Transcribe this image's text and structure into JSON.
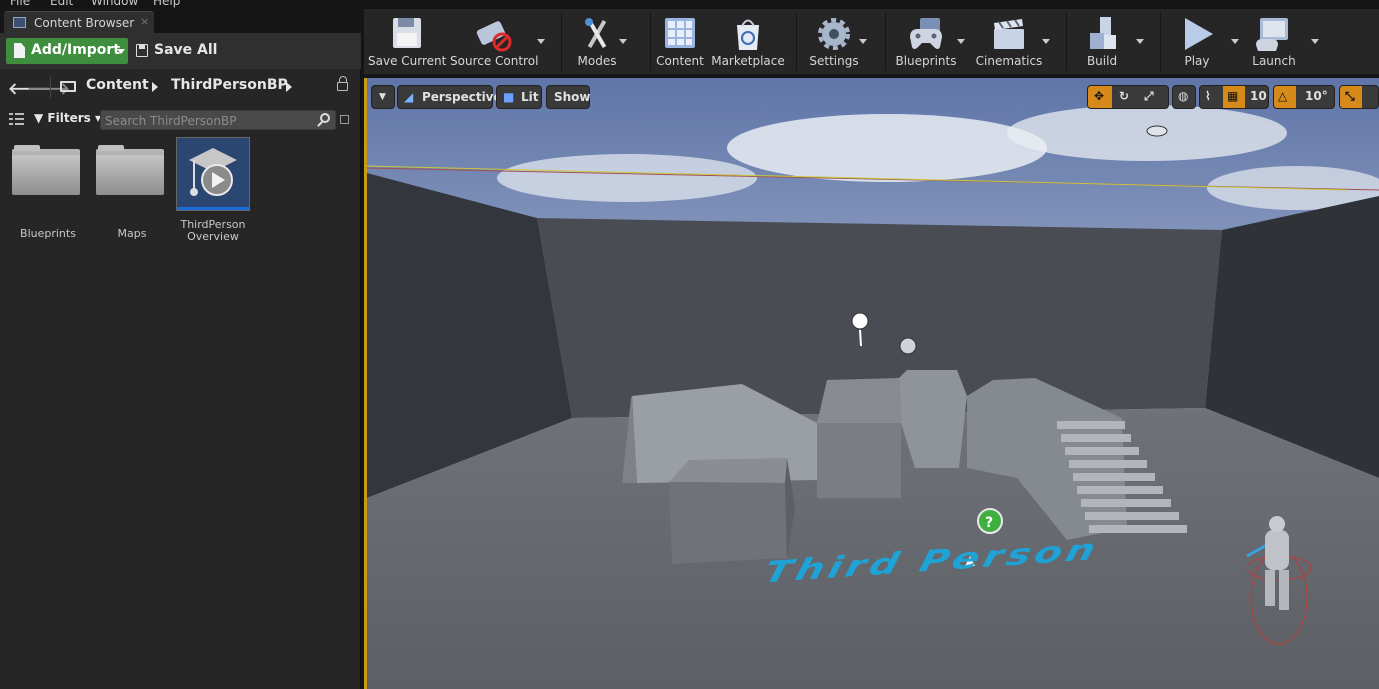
{
  "menu": {
    "items": [
      "File",
      "Edit",
      "Window",
      "Help"
    ]
  },
  "content_browser": {
    "tab_title": "Content Browser",
    "tab_close": "×",
    "add_import_label": "Add/Import",
    "save_all_label": "Save All",
    "nav_back": "🡐",
    "nav_forward": "🡒",
    "breadcrumbs": [
      "Content",
      "ThirdPersonBP"
    ],
    "filters_label": "Filters",
    "search_placeholder": "Search ThirdPersonBP",
    "assets": [
      {
        "label": "Blueprints",
        "type": "folder"
      },
      {
        "label": "Maps",
        "type": "folder"
      },
      {
        "label": "ThirdPerson Overview",
        "type": "tutorial-asset"
      }
    ]
  },
  "main_toolbar": {
    "buttons": [
      {
        "label": "Save Current",
        "icon": "floppy-disk-icon"
      },
      {
        "label": "Source Control",
        "icon": "source-control-icon"
      },
      {
        "label": "Modes",
        "icon": "modes-tools-icon"
      },
      {
        "label": "Content",
        "icon": "content-grid-icon"
      },
      {
        "label": "Marketplace",
        "icon": "marketplace-bag-icon"
      },
      {
        "label": "Settings",
        "icon": "settings-gear-icon"
      },
      {
        "label": "Blueprints",
        "icon": "blueprints-controller-icon"
      },
      {
        "label": "Cinematics",
        "icon": "clapperboard-icon"
      },
      {
        "label": "Build",
        "icon": "build-blocks-icon"
      },
      {
        "label": "Play",
        "icon": "play-triangle-icon"
      },
      {
        "label": "Launch",
        "icon": "launch-monitor-icon"
      }
    ]
  },
  "viewport": {
    "view_mode_label": "Perspective",
    "lit_label": "Lit",
    "show_label": "Show",
    "grid_snap_value": "10",
    "rotation_snap_value": "10°",
    "floor_text": "Third Person",
    "colors": {
      "accent": "#d68a19",
      "text_render": "#1fa3d6",
      "border": "#c89a16"
    }
  }
}
